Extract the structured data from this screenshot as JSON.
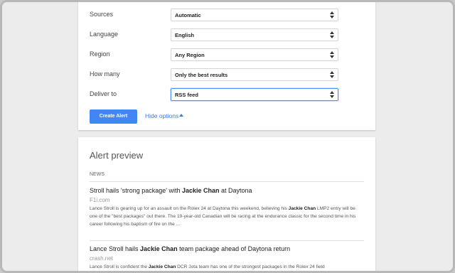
{
  "options": {
    "rows": [
      {
        "label": "Sources",
        "value": "Automatic"
      },
      {
        "label": "Language",
        "value": "English"
      },
      {
        "label": "Region",
        "value": "Any Region"
      },
      {
        "label": "How many",
        "value": "Only the best results"
      },
      {
        "label": "Deliver to",
        "value": "RSS feed"
      }
    ],
    "create_button": "Create Alert",
    "hide_options": "Hide options"
  },
  "preview": {
    "title": "Alert preview",
    "section": "NEWS",
    "items": [
      {
        "title_pre": "Stroll hails 'strong package' with ",
        "title_kw": "Jackie Chan",
        "title_post": " at Daytona",
        "source": "F1i.com",
        "snippet_pre": "Lance Stroll is gearing up for an assault on the Rolex 24 at Daytona this weekend, believing his ",
        "snippet_kw": "Jackie Chan",
        "snippet_post": " LMP2 entry will be one of the \"best packages\" out there. The 19-year-old Canadian will be racing at the endurance classic for the second time in his career following his baptism of fire on the ..."
      },
      {
        "title_pre": "Lance Stroll hails ",
        "title_kw": "Jackie Chan",
        "title_post": " team package ahead of Daytona return",
        "source": "crash.net",
        "snippet_pre": "Lance Stroll is confident the ",
        "snippet_kw": "Jackie Chan",
        "snippet_post": " DCR Jota team has one of the strongest packages in the Rolex 24 field"
      }
    ]
  }
}
